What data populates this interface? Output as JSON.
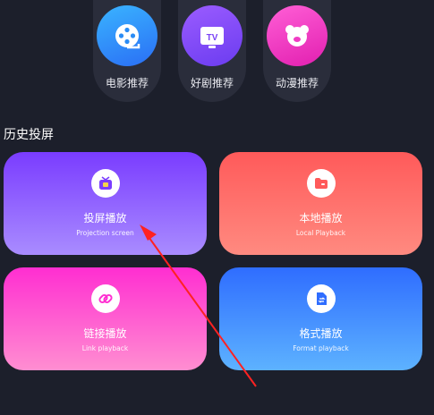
{
  "recommend": [
    {
      "label": "电影推荐",
      "icon": "film-reel-icon",
      "color_top": "#3ab4ff",
      "color_bottom": "#2a6ef5"
    },
    {
      "label": "好剧推荐",
      "icon": "tv-icon",
      "color_top": "#9b5cff",
      "color_bottom": "#6b3cf0"
    },
    {
      "label": "动漫推荐",
      "icon": "bear-face-icon",
      "color_top": "#ff5fd6",
      "color_bottom": "#e21fb0"
    }
  ],
  "section_title": "历史投屏",
  "cards": [
    {
      "title": "投屏播放",
      "subtitle": "Projection screen",
      "icon": "tv-icon",
      "color_top": "#7a3cff",
      "color_bottom": "#a98cff"
    },
    {
      "title": "本地播放",
      "subtitle": "Local Playback",
      "icon": "folder-icon",
      "color_top": "#ff5a5a",
      "color_bottom": "#ff8a80"
    },
    {
      "title": "链接播放",
      "subtitle": "Link playback",
      "icon": "link-icon",
      "color_top": "#ff2ed1",
      "color_bottom": "#ff8ed1"
    },
    {
      "title": "格式播放",
      "subtitle": "Format playback",
      "icon": "file-swap-icon",
      "color_top": "#2f6dff",
      "color_bottom": "#5db2ff"
    }
  ],
  "annotation_color": "#ff2222"
}
